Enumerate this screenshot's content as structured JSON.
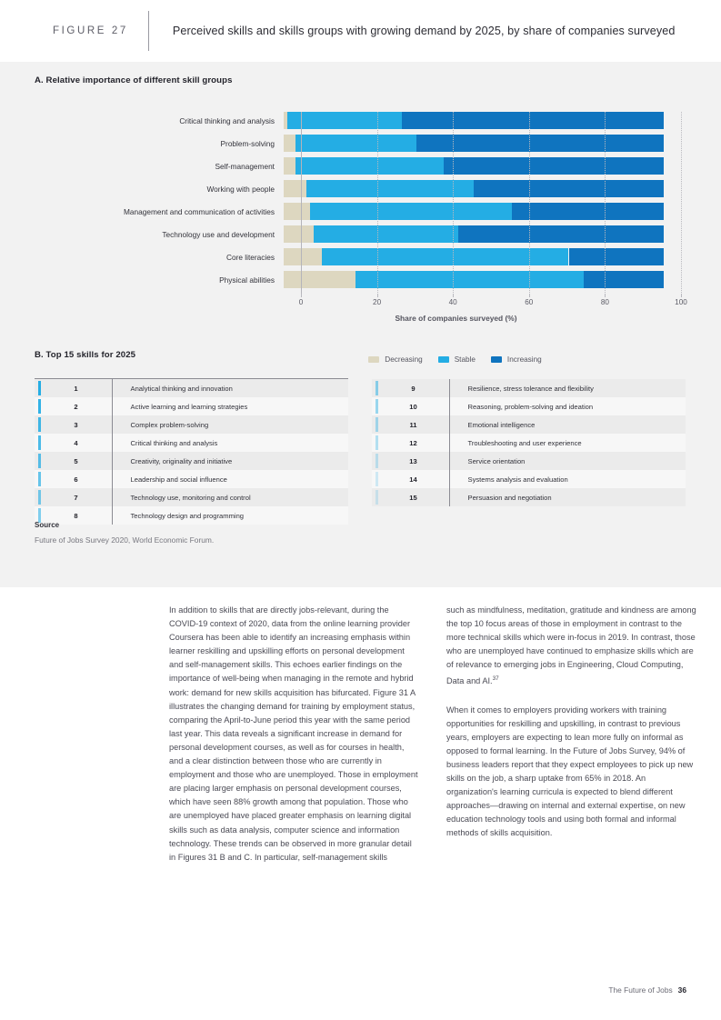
{
  "header": {
    "figure_number": "FIGURE 27",
    "title": "Perceived skills and skills groups with growing demand by 2025, by share of companies surveyed"
  },
  "panel_a": {
    "heading": "A. Relative importance of different skill groups"
  },
  "panel_b": {
    "heading": "B. Top 15 skills for 2025"
  },
  "chart_data": {
    "type": "bar",
    "orientation": "horizontal",
    "stacked": true,
    "title": "A. Relative importance of different skill groups",
    "xlabel": "Share of companies surveyed (%)",
    "ylabel": "",
    "xlim": [
      0,
      100
    ],
    "xticks": [
      0,
      20,
      40,
      60,
      80,
      100
    ],
    "grid": true,
    "legend_position": "bottom",
    "categories": [
      "Critical thinking and analysis",
      "Problem-solving",
      "Self-management",
      "Working with people",
      "Management and communication of activities",
      "Technology use and development",
      "Core literacies",
      "Physical abilities"
    ],
    "series": [
      {
        "name": "Decreasing",
        "color": "#ddd7c0",
        "values": [
          1,
          3,
          3,
          6,
          7,
          8,
          10,
          19
        ]
      },
      {
        "name": "Stable",
        "color": "#24ade4",
        "values": [
          30,
          32,
          39,
          44,
          53,
          38,
          65,
          60
        ]
      },
      {
        "name": "Increasing",
        "color": "#0f74bf",
        "values": [
          69,
          65,
          58,
          50,
          40,
          54,
          25,
          21
        ]
      }
    ]
  },
  "skills": {
    "col_left": [
      {
        "rank": "1",
        "name": "Analytical thinking and innovation"
      },
      {
        "rank": "2",
        "name": "Active learning and learning strategies"
      },
      {
        "rank": "3",
        "name": "Complex problem-solving"
      },
      {
        "rank": "4",
        "name": "Critical thinking and analysis"
      },
      {
        "rank": "5",
        "name": "Creativity, originality and initiative"
      },
      {
        "rank": "6",
        "name": "Leadership and social influence"
      },
      {
        "rank": "7",
        "name": "Technology use, monitoring and control"
      },
      {
        "rank": "8",
        "name": "Technology design and programming"
      }
    ],
    "col_right": [
      {
        "rank": "9",
        "name": "Resilience, stress tolerance and flexibility"
      },
      {
        "rank": "10",
        "name": "Reasoning, problem-solving and ideation"
      },
      {
        "rank": "11",
        "name": "Emotional intelligence"
      },
      {
        "rank": "12",
        "name": "Troubleshooting and user experience"
      },
      {
        "rank": "13",
        "name": "Service orientation"
      },
      {
        "rank": "14",
        "name": "Systems analysis and evaluation"
      },
      {
        "rank": "15",
        "name": "Persuasion and negotiation"
      }
    ]
  },
  "source": {
    "label": "Source",
    "text": "Future of Jobs Survey 2020, World Economic Forum."
  },
  "body": {
    "left": [
      "In addition to skills that are directly jobs-relevant, during the COVID-19 context of 2020, data from the online learning provider Coursera has been able to identify an increasing emphasis within learner reskilling and upskilling efforts on personal development and self-management skills. This echoes earlier findings on the importance of well-being when managing in the remote and hybrid work: demand for new skills acquisition has bifurcated. Figure 31 A illustrates the changing demand for training by employment status, comparing the April-to-June period this year with the same period last year. This data reveals a significant increase in demand for personal development courses, as well as for courses in health, and a clear distinction between those who are currently in employment and those who are unemployed. Those in employment are placing larger emphasis on personal development courses, which have seen 88% growth among that population. Those who are unemployed have placed greater emphasis on learning digital skills such as data analysis, computer science and information technology. These trends can be observed in more granular detail in Figures 31 B and C. In particular, self-management skills"
    ],
    "right": [
      "such as mindfulness, meditation, gratitude and kindness are among the top 10 focus areas of those in employment in contrast to the more technical skills which were in-focus in 2019. In contrast, those who are unemployed have continued to emphasize skills which are of relevance to emerging jobs in Engineering, Cloud Computing, Data and AI.",
      "When it comes to employers providing workers with training opportunities for reskilling and upskilling, in contrast to previous years, employers are expecting to lean more fully on informal as opposed to formal learning. In the Future of Jobs Survey, 94% of business leaders report that they expect employees to pick up new skills on the job, a sharp uptake from 65% in 2018. An organization's learning curricula is expected to blend different approaches—drawing on internal and external expertise, on new education technology tools and using both formal and informal methods of skills acquisition."
    ],
    "right_footnote_marker": "37"
  },
  "footer": {
    "text": "The Future of Jobs",
    "page": "36"
  },
  "colors": {
    "decreasing": "#ddd7c0",
    "stable": "#24ade4",
    "increasing": "#0f74bf",
    "panel_bg": "#f2f2f2",
    "accent_rank": "#24ade4"
  }
}
